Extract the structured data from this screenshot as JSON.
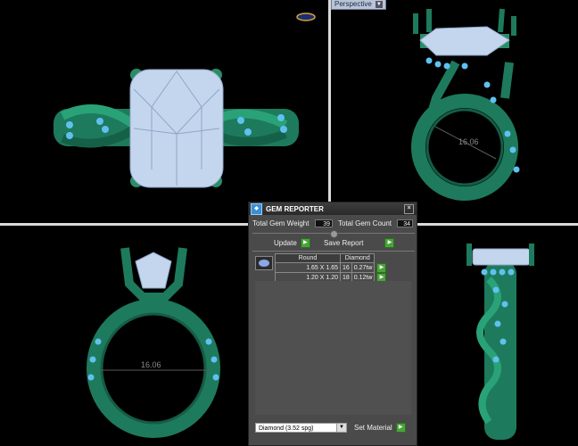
{
  "viewport": {
    "mode_label": "Perspective",
    "dimension_label": "16.06"
  },
  "colors": {
    "metal": "#1e7a5c",
    "gem": "#c4d6ee",
    "accent": "#5fc1f0"
  },
  "gem_reporter": {
    "title": "GEM REPORTER",
    "total_weight_label": "Total Gem Weight",
    "total_weight_value": "39",
    "total_count_label": "Total Gem Count",
    "total_count_value": "34",
    "update_label": "Update",
    "save_report_label": "Save Report",
    "table": {
      "headers": [
        "Round",
        "Diamond"
      ],
      "rows": [
        {
          "size": "1.65 X 1.65",
          "count": "16",
          "weight": "0.27tw"
        },
        {
          "size": "1.20 X 1.20",
          "count": "18",
          "weight": "0.12tw"
        }
      ]
    },
    "material_select": "Diamond   (3.52 spg)",
    "set_material_label": "Set Material"
  }
}
